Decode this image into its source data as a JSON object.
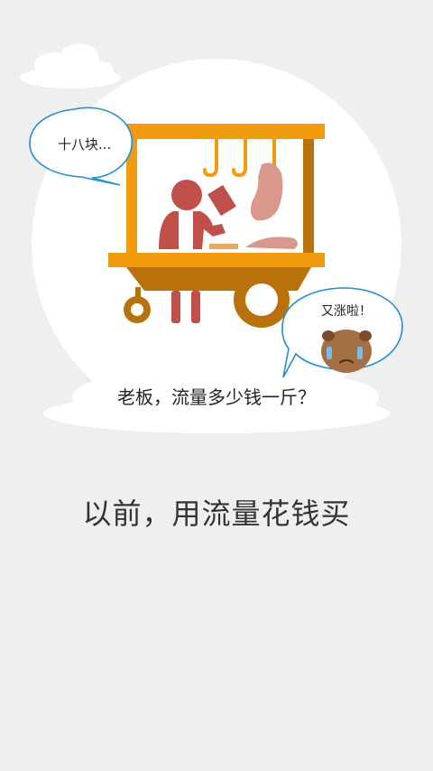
{
  "bubble_left": {
    "text": "十八块..."
  },
  "bubble_right": {
    "text": "又涨啦！"
  },
  "scene": {
    "question": "老板，流量多少钱一斤？"
  },
  "main": {
    "title": "以前，用流量花钱买"
  },
  "colors": {
    "background": "#eef0ef",
    "cart_orange": "#f29b0c",
    "cart_brown": "#b9720b",
    "vendor_red": "#c2504a",
    "meat_pink": "#d8988b",
    "bubble_border": "#1f8fd6"
  }
}
